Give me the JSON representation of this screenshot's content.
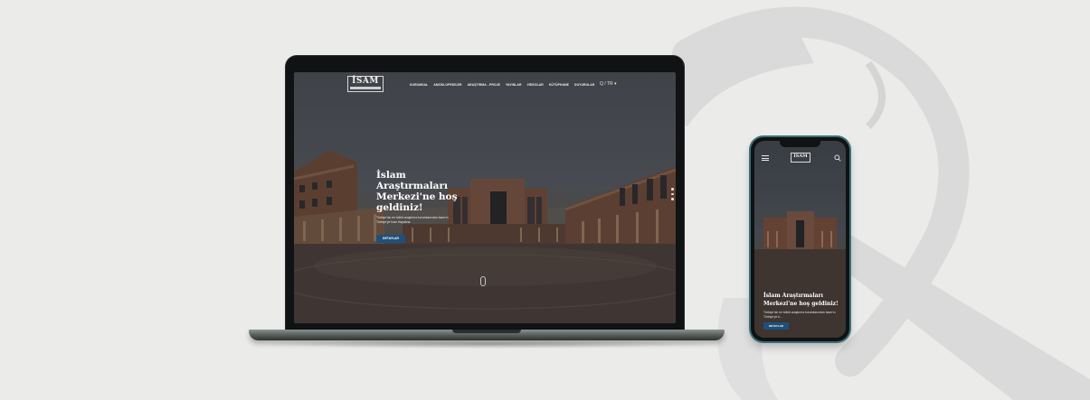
{
  "site": {
    "logo_text": "İSAM",
    "logo_subtitle": "İSLÂM ARAŞTIRMALARI MERKEZİ",
    "nav_items": [
      "KURUMSAL",
      "ANSİKLOPEDİLER",
      "ARAŞTIRMA - PROJE",
      "YAYINLAR",
      "VİDEOLAR",
      "KÜTÜPHANE",
      "DUYURULAR"
    ],
    "nav_tools": "Q  /  TR ▾",
    "hero_title": "İslam Araştırmaları Merkezi'ne hoş geldiniz!",
    "hero_description": "Türkiye'nin en köklü araştırma kurumlarından İsam'ın Türkiye'ye İnan Hayatına",
    "hero_button": "DETAYLAR"
  },
  "phone": {
    "logo_text": "İSAM",
    "hero_title": "İslam Araştırmaları Merkezi'ne hoş geldiniz!",
    "hero_description": "Türkiye'nin en köklü araştırma kurumlarından İsam'ın Türkiye'ye ü...",
    "hero_button": "DETAYLAR"
  },
  "icons": {
    "background_logo": "isam-emblem-icon",
    "search": "search-icon",
    "menu": "hamburger-menu-icon"
  },
  "colors": {
    "background": "#ebebe9",
    "device_frame": "#101214",
    "button_blue": "#1f4f7a",
    "phone_frame_accent": "#3c6f78"
  }
}
